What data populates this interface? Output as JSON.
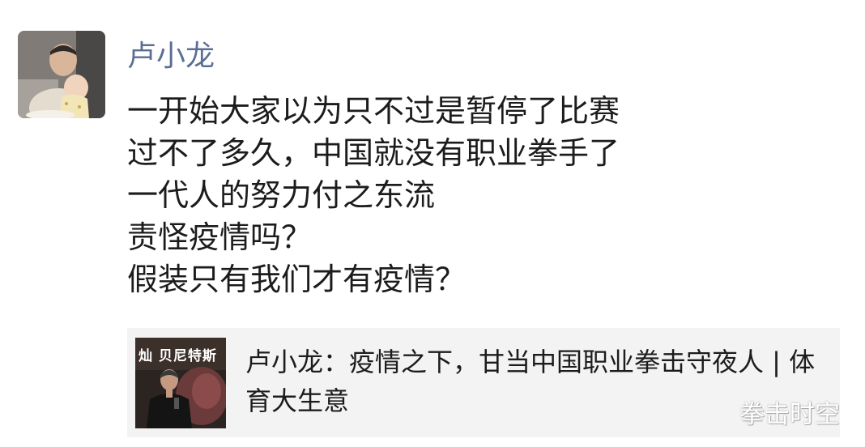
{
  "post": {
    "author": "卢小龙",
    "lines": [
      "一开始大家以为只不过是暂停了比赛",
      "过不了多久，中国就没有职业拳手了",
      "一代人的努力付之东流",
      "责怪疫情吗？",
      "假装只有我们才有疫情？"
    ]
  },
  "link_card": {
    "thumbnail_caption": "灿 贝尼特斯",
    "title": "卢小龙：疫情之下，甘当中国职业拳击守夜人 | 体育大生意"
  },
  "watermark": "拳击时空",
  "colors": {
    "author_name": "#5a6e94",
    "body_text": "#1c1c1c",
    "card_background": "#f3f3f3"
  }
}
